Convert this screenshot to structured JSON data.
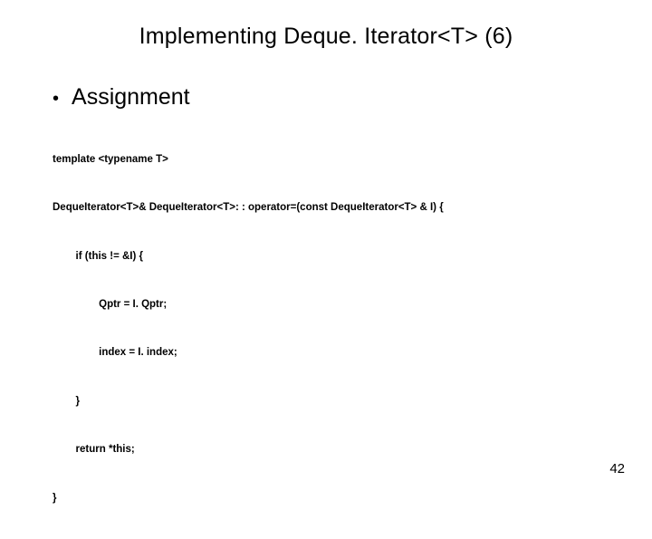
{
  "title": "Implementing Deque. Iterator<T> (6)",
  "bullet": "Assignment",
  "code_lines": [
    "template <typename T>",
    "DequeIterator<T>& DequeIterator<T>: : operator=(const DequeIterator<T> & I) {",
    "        if (this != &I) {",
    "                Qptr = I. Qptr;",
    "                index = I. index;",
    "        }",
    "        return *this;",
    "}"
  ],
  "page_number": "42"
}
